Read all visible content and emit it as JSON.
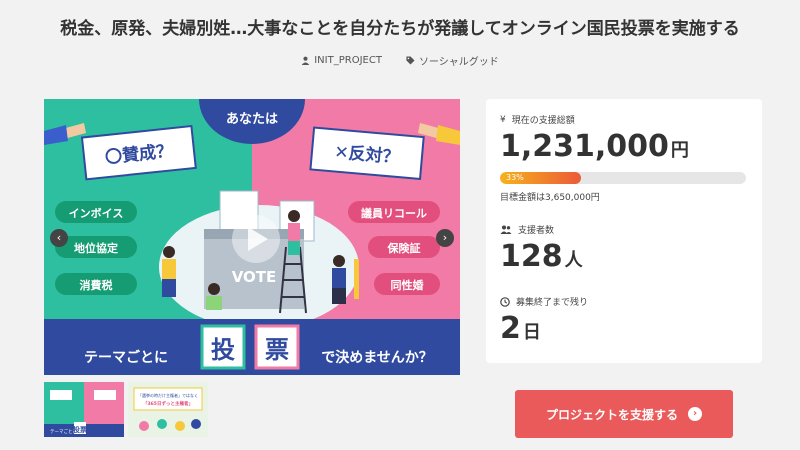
{
  "project": {
    "title": "税金、原発、夫婦別姓…大事なことを自分たちが発議してオンライン国民投票を実施する",
    "author": "INIT_PROJECT",
    "category": "ソーシャルグッド"
  },
  "hero": {
    "top_label": "あなたは",
    "pro_label": "〇賛成？",
    "con_label": "✕反対？",
    "pro_topics": [
      "インボイス",
      "地位協定",
      "消費税"
    ],
    "con_topics": [
      "議員リコール",
      "保険証",
      "同性婚"
    ],
    "ballot_box_text": "VOTE",
    "banner_prefix": "テーマごとに",
    "banner_char1": "投",
    "banner_char2": "票",
    "banner_suffix": "で決めませんか？",
    "prev_arrow": "‹",
    "next_arrow": "›",
    "colors": {
      "pro_bg": "#2ebfa0",
      "con_bg": "#f27aa6",
      "navy": "#2f4a9e",
      "topic_pro": "#169c73",
      "topic_con": "#e24f7e"
    }
  },
  "thumbnails": [
    {
      "name": "thumb-1",
      "caption_lines": [
        "テーマごとに",
        "投票"
      ]
    },
    {
      "name": "thumb-2",
      "caption_lines": [
        "「選挙の時だけ主権者」ではなく",
        "「365日ずっと主権者」"
      ]
    }
  ],
  "stats": {
    "total_label": "現在の支援総額",
    "total_value": "1,231,000",
    "total_unit": "円",
    "progress_percent": 33,
    "progress_label": "33%",
    "goal_text": "目標金額は3,650,000円",
    "supporters_label": "支援者数",
    "supporters_value": "128",
    "supporters_unit": "人",
    "remaining_label": "募集終了まで残り",
    "remaining_value": "2",
    "remaining_unit": "日",
    "yen_icon": "¥",
    "colors": {
      "progress_start": "#f6b21c",
      "progress_end": "#ec5a39"
    }
  },
  "cta": {
    "support_label": "プロジェクトを支援する",
    "arrow": "›",
    "color": "#ea5a5a"
  }
}
